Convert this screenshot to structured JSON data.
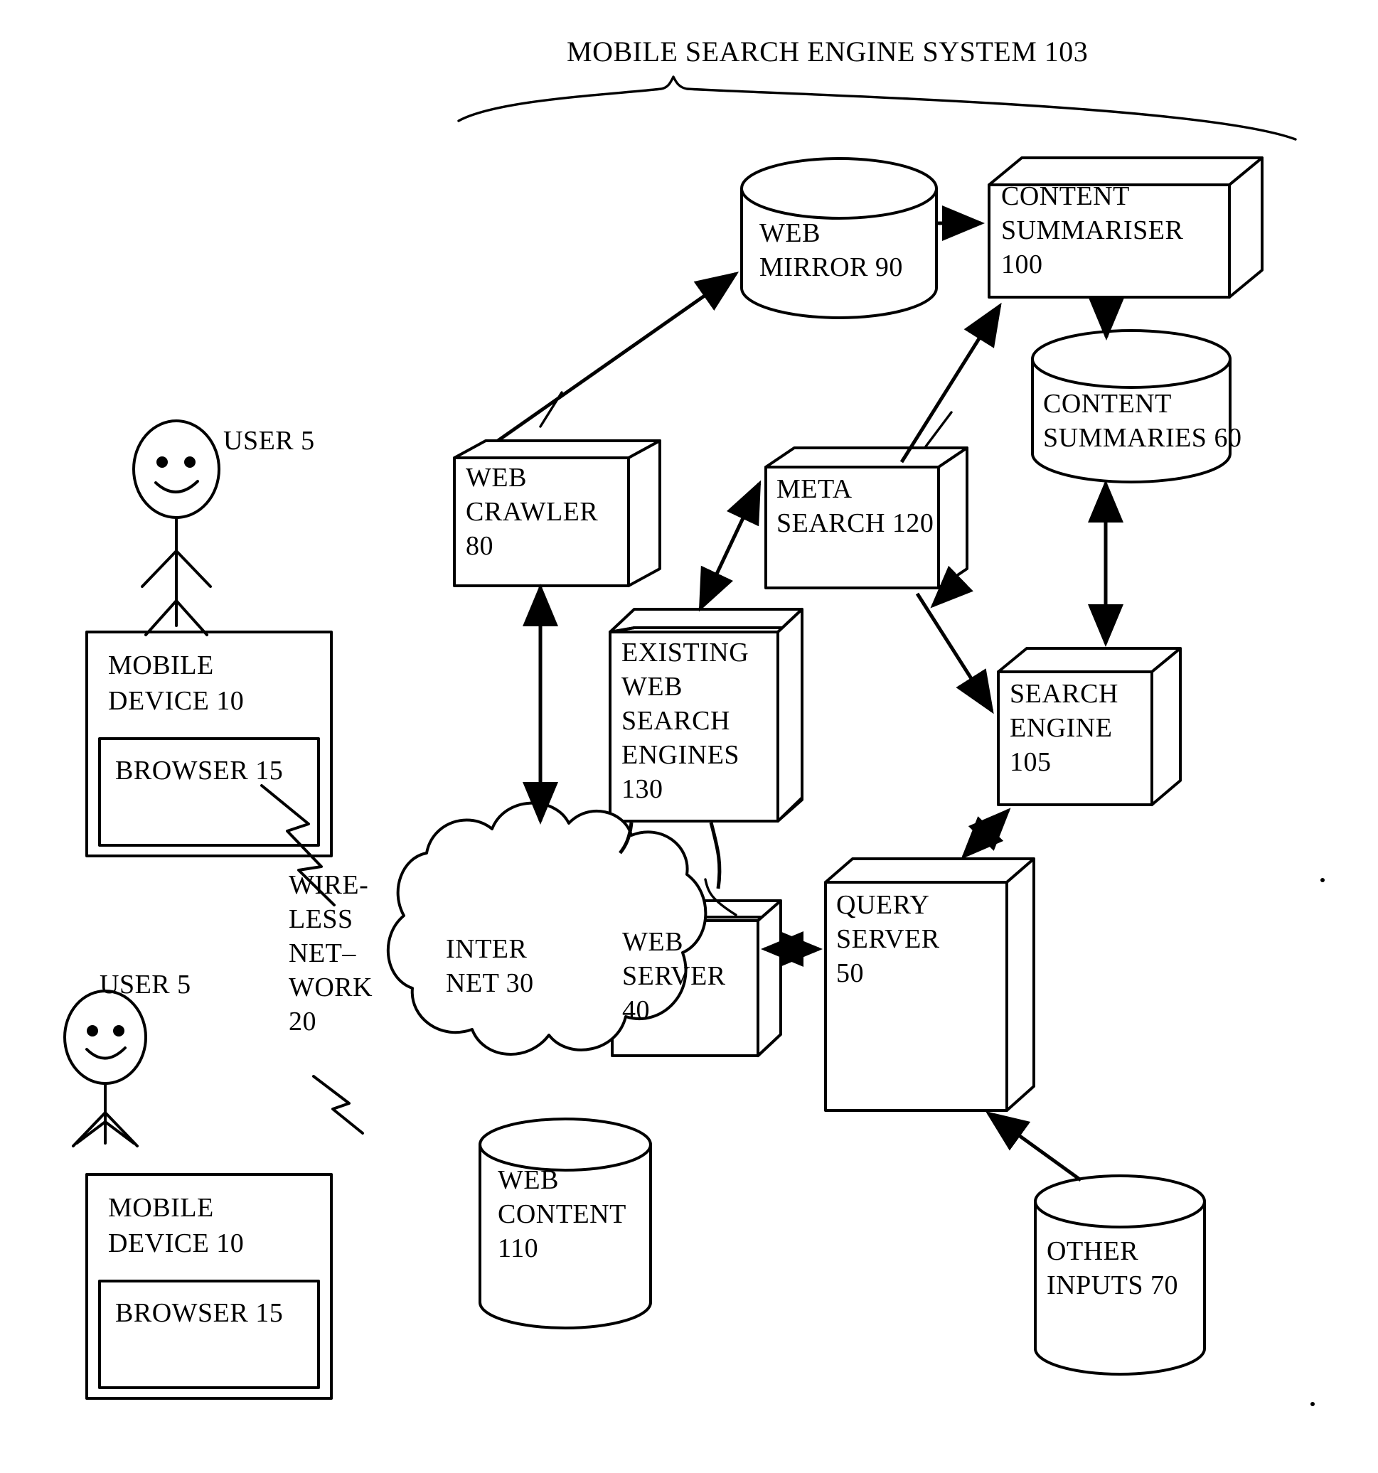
{
  "figure": {
    "title": "MOBILE SEARCH ENGINE SYSTEM  103",
    "background_color": "#ffffff",
    "line_color": "#000000",
    "type": "patent-system-block-diagram"
  },
  "actors": [
    {
      "id": "user-top",
      "label": "USER 5"
    },
    {
      "id": "user-bottom",
      "label": "USER 5"
    }
  ],
  "devices": [
    {
      "id": "mobile-device-top",
      "label_line1": "MOBILE",
      "label_line2": "DEVICE 10",
      "browser_label": "BROWSER 15"
    },
    {
      "id": "mobile-device-bottom",
      "label_line1": "MOBILE",
      "label_line2": "DEVICE 10",
      "browser_label": "BROWSER 15"
    }
  ],
  "network": {
    "wireless": {
      "line1": "WIRE-",
      "line2": "LESS",
      "line3": "NET–",
      "line4": "WORK",
      "line5": "20"
    },
    "internet": {
      "line1": "INTER",
      "line2": "NET 30"
    }
  },
  "blocks": [
    {
      "id": "web-crawler",
      "shape": "box3d",
      "lines": [
        "WEB",
        "CRAWLER",
        "80"
      ]
    },
    {
      "id": "content-summariser",
      "shape": "box3d",
      "lines": [
        "CONTENT",
        "SUMMARISER",
        "100"
      ]
    },
    {
      "id": "meta-search",
      "shape": "box3d",
      "lines": [
        "META",
        "SEARCH 120"
      ]
    },
    {
      "id": "existing-web-search-engines",
      "shape": "box3d",
      "lines": [
        "EXISTING",
        "WEB",
        "SEARCH",
        "ENGINES",
        "130"
      ]
    },
    {
      "id": "search-engine",
      "shape": "box3d",
      "lines": [
        "SEARCH",
        "ENGINE",
        "105"
      ]
    },
    {
      "id": "web-server",
      "shape": "box3d",
      "lines": [
        "WEB",
        "SERVER",
        "40"
      ]
    },
    {
      "id": "query-server",
      "shape": "box3d",
      "lines": [
        "QUERY",
        "SERVER",
        "50"
      ]
    }
  ],
  "datastores": [
    {
      "id": "web-mirror",
      "shape": "cylinder",
      "lines": [
        "WEB",
        "MIRROR 90"
      ]
    },
    {
      "id": "content-summaries",
      "shape": "cylinder",
      "lines": [
        "CONTENT",
        "SUMMARIES 60"
      ]
    },
    {
      "id": "web-content",
      "shape": "cylinder",
      "lines": [
        "WEB",
        "CONTENT",
        "110"
      ]
    },
    {
      "id": "other-inputs",
      "shape": "cylinder",
      "lines": [
        "OTHER",
        "INPUTS 70"
      ]
    }
  ],
  "connections": [
    {
      "from": "web-crawler",
      "to": "web-mirror",
      "style": "arrow"
    },
    {
      "from": "web-mirror",
      "to": "content-summariser",
      "style": "arrow"
    },
    {
      "from": "content-summariser",
      "to": "content-summaries",
      "style": "arrow"
    },
    {
      "from": "content-summaries",
      "to": "search-engine",
      "style": "double-arrow"
    },
    {
      "from": "meta-search",
      "to": "content-summariser",
      "style": "arrow"
    },
    {
      "from": "meta-search",
      "to": "existing-web-search-engines",
      "style": "double-arrow"
    },
    {
      "from": "meta-search",
      "to": "search-engine",
      "style": "double-arrow"
    },
    {
      "from": "web-crawler",
      "to": "internet",
      "style": "double-arrow"
    },
    {
      "from": "existing-web-search-engines",
      "to": "internet",
      "style": "line"
    },
    {
      "from": "web-server",
      "to": "query-server",
      "style": "double-arrow"
    },
    {
      "from": "query-server",
      "to": "search-engine",
      "style": "double-arrow"
    },
    {
      "from": "other-inputs",
      "to": "query-server",
      "style": "arrow"
    },
    {
      "from": "mobile-device-top",
      "to": "wireless-network",
      "style": "lightning"
    },
    {
      "from": "mobile-device-bottom",
      "to": "wireless-network",
      "style": "lightning"
    }
  ]
}
